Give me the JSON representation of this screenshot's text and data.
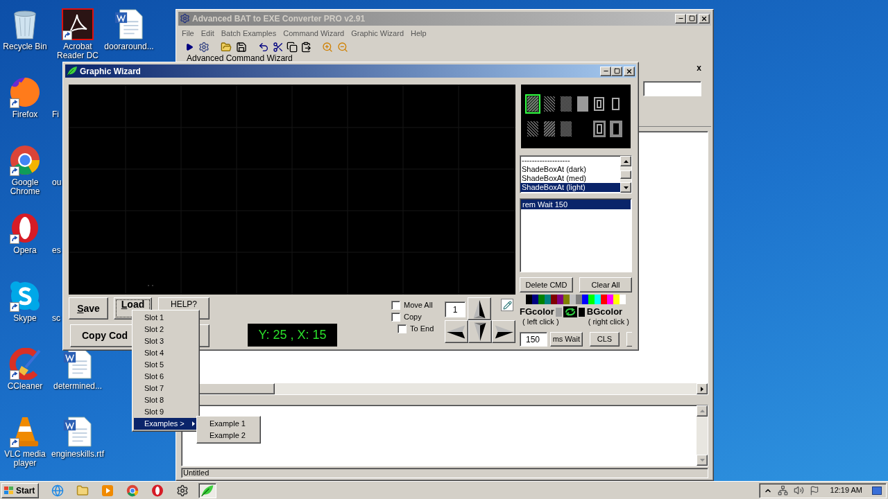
{
  "desktop_columns": [
    [
      {
        "label": "Recycle Bin",
        "kind": "trash",
        "shortcut": false
      },
      {
        "label": "Firefox",
        "kind": "firefox",
        "shortcut": true
      },
      {
        "label": "Google Chrome",
        "kind": "chrome",
        "shortcut": true
      },
      {
        "label": "Opera",
        "kind": "opera",
        "shortcut": true
      },
      {
        "label": "Skype",
        "kind": "skype",
        "shortcut": true
      },
      {
        "label": "CCleaner",
        "kind": "ccleaner",
        "shortcut": true
      },
      {
        "label": "VLC media player",
        "kind": "vlc",
        "shortcut": true
      }
    ],
    [
      {
        "label": "Acrobat Reader DC",
        "kind": "pdf",
        "shortcut": true
      },
      {
        "label": "Fi",
        "kind": "covered"
      },
      {
        "label": "ou",
        "kind": "covered"
      },
      {
        "label": "es",
        "kind": "covered"
      },
      {
        "label": "sc",
        "kind": "covered"
      },
      {
        "label": "determined...",
        "kind": "word",
        "shortcut": false
      },
      {
        "label": "engineskills.rtf",
        "kind": "word",
        "shortcut": false
      }
    ],
    [
      {
        "label": "dooraround...",
        "kind": "word",
        "shortcut": false
      }
    ]
  ],
  "main_window": {
    "title": "Advanced BAT to EXE Converter PRO v2.91",
    "active": false,
    "menu": [
      "File",
      "Edit",
      "Batch Examples",
      "Command Wizard",
      "Graphic Wizard",
      "Help"
    ],
    "toolbar": [
      {
        "kind": "run"
      },
      {
        "kind": "build"
      },
      {
        "kind": "gap"
      },
      {
        "kind": "open"
      },
      {
        "kind": "save"
      },
      {
        "kind": "gap"
      },
      {
        "kind": "undo"
      },
      {
        "kind": "cut"
      },
      {
        "kind": "copy"
      },
      {
        "kind": "paste"
      },
      {
        "kind": "gap"
      },
      {
        "kind": "zoom-in"
      },
      {
        "kind": "zoom-out"
      }
    ],
    "group_label": "Advanced Command Wizard",
    "panel_close": "x",
    "status": "Untitled"
  },
  "graphic_wizard": {
    "title": "Graphic Wizard",
    "active": true,
    "patterns": [
      {
        "kind": "hatch-dense",
        "selected": true
      },
      {
        "kind": "hatch",
        "selected": false
      },
      {
        "kind": "checker",
        "selected": false
      },
      {
        "kind": "solid",
        "selected": false
      },
      {
        "kind": "frame-double",
        "selected": false
      },
      {
        "kind": "frame",
        "selected": false
      },
      {
        "kind": "hatch",
        "selected": false
      },
      {
        "kind": "hatch-dense",
        "selected": false
      },
      {
        "kind": "checker",
        "selected": false
      },
      {
        "kind": "blank"
      },
      {
        "kind": "frame-double-filled",
        "selected": false
      },
      {
        "kind": "frame-filled",
        "selected": false
      }
    ],
    "command_types": [
      {
        "label": "-------------------",
        "selected": false
      },
      {
        "label": "ShadeBoxAt (dark)",
        "selected": false
      },
      {
        "label": "ShadeBoxAt (med)",
        "selected": false
      },
      {
        "label": "ShadeBoxAt (light)",
        "selected": true
      }
    ],
    "commands": [
      {
        "label": "rem Wait 150",
        "selected": true
      }
    ],
    "buttons": {
      "delete": "Delete CMD",
      "clear": "Clear All",
      "save": "Save",
      "load": "Load",
      "help": "HELP?",
      "copy": "Copy Cod",
      "wait": "ms Wait",
      "cls": "CLS"
    },
    "palette": [
      {
        "color": "#000000"
      },
      {
        "color": "#000080"
      },
      {
        "color": "#008000"
      },
      {
        "color": "#008080"
      },
      {
        "color": "#800000"
      },
      {
        "color": "#800080"
      },
      {
        "color": "#808000"
      },
      {
        "color": "#c0c0c0"
      },
      {
        "color": "#808080"
      },
      {
        "color": "#0000ff"
      },
      {
        "color": "#00ff00"
      },
      {
        "color": "#00ffff"
      },
      {
        "color": "#ff0000"
      },
      {
        "color": "#ff00ff"
      },
      {
        "color": "#ffff00"
      },
      {
        "color": "#ffffff"
      }
    ],
    "fg": {
      "label": "FGcolor",
      "hint": "( left click )",
      "color": "#a0a0a0"
    },
    "bg": {
      "label": "BGcolor",
      "hint": "( right click )",
      "color": "#000000"
    },
    "wait_value": "150",
    "step_value": "1",
    "options": [
      {
        "label": "Move All",
        "checked": false
      },
      {
        "label": "Copy",
        "checked": false
      },
      {
        "label": "To End",
        "checked": false
      }
    ],
    "position": "Y: 25 , X: 15"
  },
  "load_menu": {
    "items": [
      {
        "label": "Slot 1",
        "kind": "item",
        "selected": false
      },
      {
        "label": "Slot 2",
        "kind": "item",
        "selected": false
      },
      {
        "label": "Slot 3",
        "kind": "item",
        "selected": false
      },
      {
        "label": "Slot 4",
        "kind": "item",
        "selected": false
      },
      {
        "label": "Slot 5",
        "kind": "item",
        "selected": false
      },
      {
        "label": "Slot 6",
        "kind": "item",
        "selected": false
      },
      {
        "label": "Slot 7",
        "kind": "item",
        "selected": false
      },
      {
        "label": "Slot 8",
        "kind": "item",
        "selected": false
      },
      {
        "label": "Slot 9",
        "kind": "item",
        "selected": false
      },
      {
        "label": "Examples >",
        "kind": "submenu",
        "selected": true
      }
    ],
    "submenu": [
      {
        "label": "Example 1",
        "selected": false
      },
      {
        "label": "Example 2",
        "selected": false
      }
    ]
  },
  "taskbar": {
    "start": "Start",
    "apps": [
      {
        "kind": "ie",
        "active": false
      },
      {
        "kind": "folder",
        "active": false
      },
      {
        "kind": "media",
        "active": false
      },
      {
        "kind": "chrome",
        "active": false
      },
      {
        "kind": "opera",
        "active": false
      },
      {
        "kind": "bat",
        "active": false
      },
      {
        "kind": "leaf",
        "active": true
      }
    ],
    "time": "12:19 AM"
  }
}
